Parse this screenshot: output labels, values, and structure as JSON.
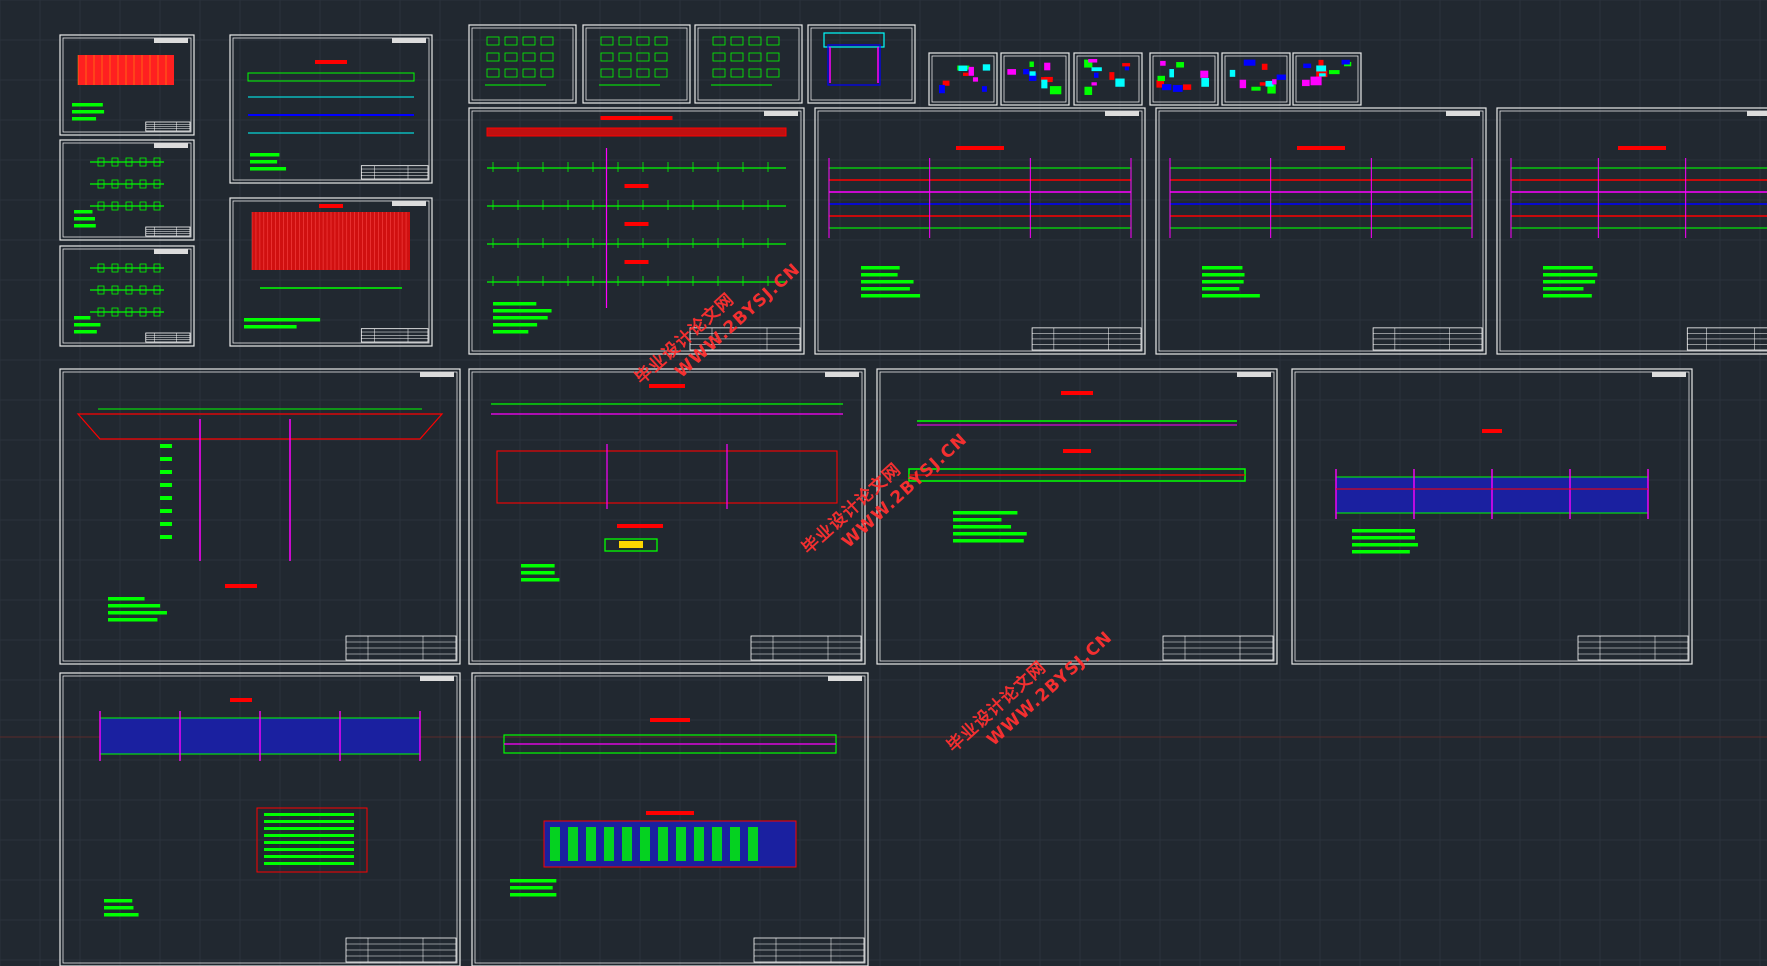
{
  "workspace": {
    "background": "#212830",
    "grid_color": "#2a323c",
    "sheet_border": "#e8e8e8",
    "cad_green": "#00ff00",
    "cad_red": "#ff0000",
    "cad_magenta": "#ff00ff",
    "cad_blue": "#0000ff",
    "cad_cyan": "#00ffff"
  },
  "watermarks": [
    {
      "cn": "毕业设计论文网",
      "url": "WWW.2BYSJ.CN"
    },
    {
      "cn": "毕业设计论文网",
      "url": "WWW.2BYSJ.CN"
    },
    {
      "cn": "毕业设计论文网",
      "url": "WWW.2BYSJ.CN"
    }
  ],
  "drawing_sheets": [
    "sheet-01",
    "sheet-02",
    "sheet-03",
    "sheet-04",
    "sheet-05",
    "sheet-06",
    "sheet-07",
    "sheet-08",
    "sheet-09",
    "sheet-10",
    "sheet-11",
    "sheet-12",
    "sheet-13",
    "sheet-14",
    "sheet-15",
    "sheet-16",
    "sheet-17",
    "sheet-18",
    "sheet-19",
    "sheet-20",
    "sheet-21",
    "sheet-22",
    "sheet-23",
    "sheet-24",
    "sheet-25",
    "sheet-26",
    "sheet-27"
  ]
}
